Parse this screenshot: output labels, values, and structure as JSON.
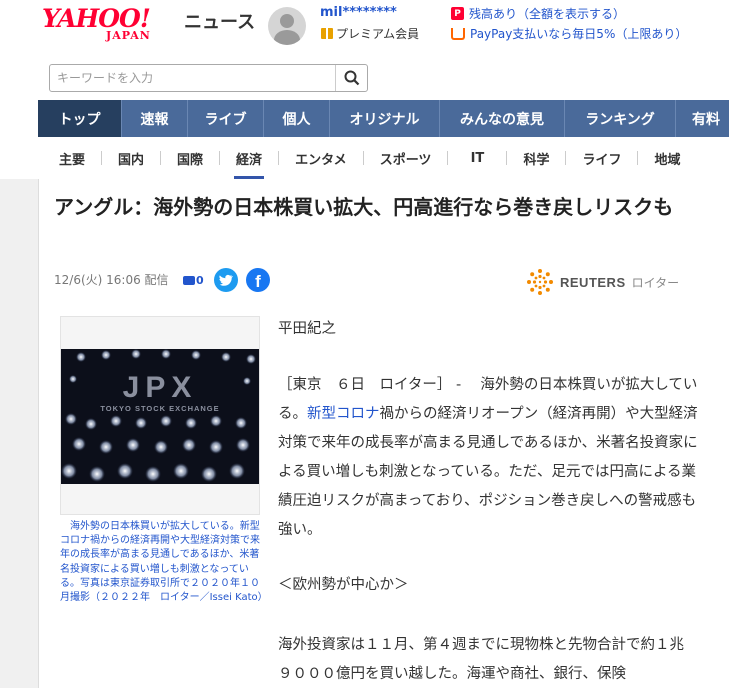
{
  "header": {
    "logo_yahoo": "YAHOO!",
    "logo_japan": "JAPAN",
    "logo_news": "ニュース",
    "user_name": "mil********",
    "premium_label": "プレミアム会員",
    "points_link": "残高あり（全額を表示する）",
    "paypay_link": "PayPay支払いなら毎日5%（上限あり）"
  },
  "search": {
    "placeholder": "キーワードを入力"
  },
  "main_nav": [
    {
      "label": "トップ",
      "active": true
    },
    {
      "label": "速報"
    },
    {
      "label": "ライブ"
    },
    {
      "label": "個人"
    },
    {
      "label": "オリジナル"
    },
    {
      "label": "みんなの意見"
    },
    {
      "label": "ランキング"
    },
    {
      "label": "有料"
    }
  ],
  "sub_nav": [
    {
      "label": "主要"
    },
    {
      "label": "国内"
    },
    {
      "label": "国際"
    },
    {
      "label": "経済",
      "active": true
    },
    {
      "label": "エンタメ"
    },
    {
      "label": "スポーツ"
    },
    {
      "label": "IT"
    },
    {
      "label": "科学"
    },
    {
      "label": "ライフ"
    },
    {
      "label": "地域"
    }
  ],
  "article": {
    "title": "アングル：海外勢の日本株買い拡大、円高進行なら巻き戻しリスクも",
    "date": "12/6(火) 16:06 配信",
    "comment_count": "0",
    "source_name": "REUTERS",
    "source_sub": "ロイター",
    "photo_text_main": "JPX",
    "photo_text_sub": "TOKYO STOCK EXCHANGE",
    "caption": "海外勢の日本株買いが拡大している。新型コロナ禍からの経済再開や大型経済対策で来年の成長率が高まる見通しであるほか、米著名投資家による買い増しも刺激となっている。写真は東京証券取引所で２０２０年１０月撮影（２０２２年　ロイター／Issei Kato）",
    "author": "平田紀之",
    "para1_before": "［東京　６日　ロイター］ -　 海外勢の日本株買いが拡大している。",
    "para1_link": "新型コロナ",
    "para1_after": "禍からの経済リオープン（経済再開）や大型経済対策で来年の成長率が高まる見通しであるほか、米著名投資家による買い増しも刺激となっている。ただ、足元では円高による業績圧迫リスクが高まっており、ポジション巻き戻しへの警戒感も強い。",
    "subheading": "＜欧州勢が中心か＞",
    "para2": "海外投資家は１１月、第４週までに現物株と先物合計で約１兆９０００億円を買い越した。海運や商社、銀行、保険"
  },
  "colors": {
    "brand_red": "#ff0033",
    "nav_blue": "#4a6a9a",
    "nav_active": "#263f5f",
    "link_blue": "#2255cc"
  }
}
